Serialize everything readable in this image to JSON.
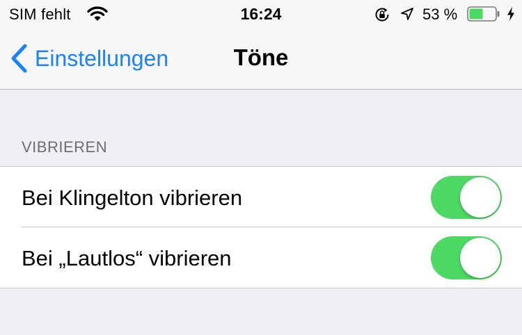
{
  "status_bar": {
    "carrier": "SIM fehlt",
    "time": "16:24",
    "battery_percent": "53 %",
    "battery_level": 0.53,
    "battery_color": "#4cd964",
    "icons": [
      "wifi-icon",
      "rotation-lock-icon",
      "location-icon",
      "battery-icon",
      "charging-bolt-icon"
    ]
  },
  "nav": {
    "back_label": "Einstellungen",
    "title": "Töne",
    "tint_color": "#1a82fb"
  },
  "section": {
    "header": "VIBRIEREN",
    "rows": [
      {
        "label": "Bei Klingelton vibrieren",
        "toggle_on": true
      },
      {
        "label": "Bei „Lautlos“ vibrieren",
        "toggle_on": true
      }
    ],
    "toggle_on_color": "#4cd964"
  }
}
